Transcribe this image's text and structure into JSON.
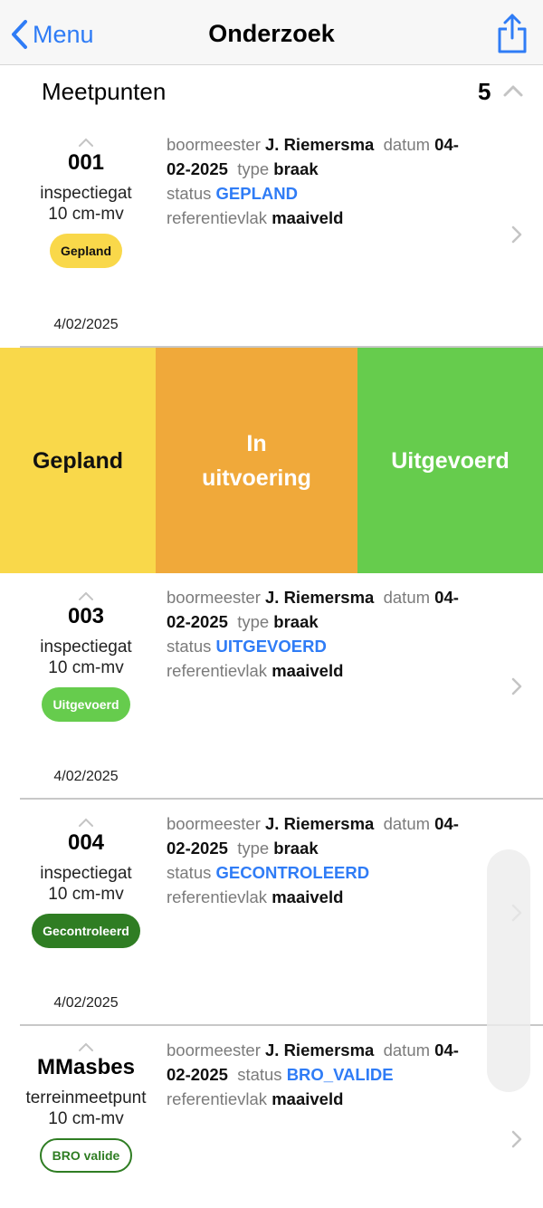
{
  "nav": {
    "back_label": "Menu",
    "title": "Onderzoek"
  },
  "section": {
    "title": "Meetpunten",
    "count": "5"
  },
  "labels": {
    "boormeester": "boormeester",
    "datum": "datum",
    "type": "type",
    "status": "status",
    "referentievlak": "referentievlak"
  },
  "rows": [
    {
      "id": "001",
      "kind": "inspectiegat",
      "depth": "10 cm-mv",
      "badge": "Gepland",
      "date": "4/02/2025",
      "boormeester": "J. Riemersma",
      "datum_a": "04-",
      "datum_b": "02-2025",
      "type": "braak",
      "status": "GEPLAND",
      "referentievlak": "maaiveld"
    },
    {
      "id": "003",
      "kind": "inspectiegat",
      "depth": "10 cm-mv",
      "badge": "Uitgevoerd",
      "date": "4/02/2025",
      "boormeester": "J. Riemersma",
      "datum_a": "04-",
      "datum_b": "02-2025",
      "type": "braak",
      "status": "UITGEVOERD",
      "referentievlak": "maaiveld"
    },
    {
      "id": "004",
      "kind": "inspectiegat",
      "depth": "10 cm-mv",
      "badge": "Gecontroleerd",
      "date": "4/02/2025",
      "boormeester": "J. Riemersma",
      "datum_a": "04-",
      "datum_b": "02-2025",
      "type": "braak",
      "status": "GECONTROLEERD",
      "referentievlak": "maaiveld"
    },
    {
      "id": "MMasbes",
      "kind": "terreinmeetpunt",
      "depth": "10 cm-mv",
      "badge": "BRO valide",
      "boormeester": "J. Riemersma",
      "datum_a": "04-",
      "datum_b": "02-2025",
      "status": "BRO_VALIDE",
      "referentievlak": "maaiveld"
    }
  ],
  "swipe_actions": {
    "planned": "Gepland",
    "in_progress_line1": "In",
    "in_progress_line2": "uitvoering",
    "done": "Uitgevoerd"
  },
  "colors": {
    "accent_blue": "#2f7cf6",
    "gepland_yellow": "#f9d84a",
    "in_uitvoering_orange": "#f0a93a",
    "uitgevoerd_green": "#66cc4d",
    "gecontroleerd_dark_green": "#2f7d23",
    "bro_valide_outline": "#2f7d23"
  },
  "icons": {
    "back": "chevron-left-icon",
    "share": "share-icon",
    "collapse": "chevron-up-icon",
    "row_disclosure": "chevron-right-icon"
  }
}
